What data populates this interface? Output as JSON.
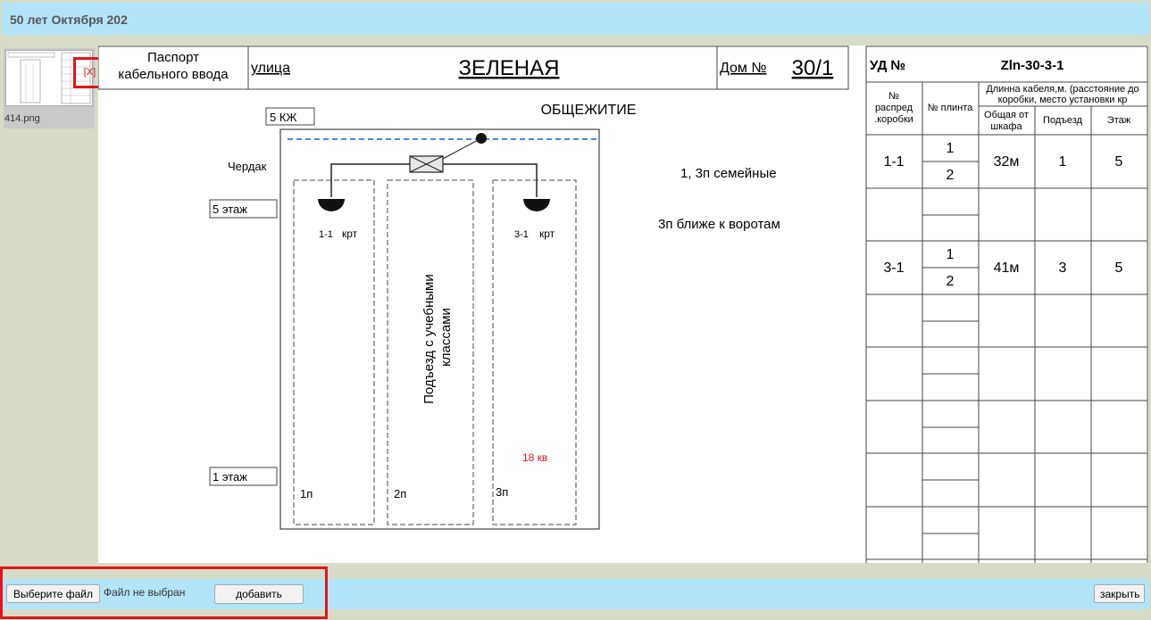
{
  "header": {
    "title": "50 лет Октября 202"
  },
  "attachment": {
    "filename": "414.png",
    "remove_label": "[X]"
  },
  "passport": {
    "label_line1": "Паспорт",
    "label_line2": "кабельного ввода",
    "street_label": "улица",
    "street_name": "ЗЕЛЕНАЯ",
    "house_label": "Дом №",
    "house_number": "30/1",
    "building_type": "ОБЩЕЖИТИЕ"
  },
  "scheme": {
    "tag_kzh": "5  КЖ",
    "attic": "Чердак",
    "floor5": "5  этаж",
    "floor1": "1  этаж",
    "box1": "1-1",
    "box1_krt": "крт",
    "box3": "3-1",
    "box3_krt": "крт",
    "entrance_note": "Подъезд с учебными классами",
    "entrance1": "1п",
    "entrance2": "2п",
    "entrance3": "3п",
    "apartments_note": "18 кв"
  },
  "notes": {
    "note1": "1, 3п семейные",
    "note2": "3п ближе к воротам"
  },
  "ud_table": {
    "ud_label": "УД №",
    "ud_number": "Zln-30-3-1",
    "col_box": "№ распред .коробки",
    "col_plint": "№ плинта",
    "col_length": "Длинна кабеля,м. (расстояние до коробки, место установки кр",
    "col_total": "Общая от шкафа",
    "col_entrance": "Подъезд",
    "col_floor": "Этаж",
    "rows": [
      {
        "box": "1-1",
        "plint1": "1",
        "plint2": "2",
        "total": "32м",
        "entrance": "1",
        "floor": "5"
      },
      {
        "box": "",
        "plint1": "",
        "plint2": "",
        "total": "",
        "entrance": "",
        "floor": ""
      },
      {
        "box": "3-1",
        "plint1": "1",
        "plint2": "2",
        "total": "41м",
        "entrance": "3",
        "floor": "5"
      },
      {
        "box": "",
        "plint1": "",
        "plint2": "",
        "total": "",
        "entrance": "",
        "floor": ""
      },
      {
        "box": "",
        "plint1": "",
        "plint2": "",
        "total": "",
        "entrance": "",
        "floor": ""
      },
      {
        "box": "",
        "plint1": "",
        "plint2": "",
        "total": "",
        "entrance": "",
        "floor": ""
      },
      {
        "box": "",
        "plint1": "",
        "plint2": "",
        "total": "",
        "entrance": "",
        "floor": ""
      },
      {
        "box": "",
        "plint1": "",
        "plint2": "",
        "total": "",
        "entrance": "",
        "floor": ""
      }
    ]
  },
  "footer": {
    "choose_file": "Выберите файл",
    "file_status": "Файл не выбран",
    "add": "добавить",
    "close": "закрыть"
  },
  "colors": {
    "bar": "#b3e5fa",
    "highlight": "#e0161a",
    "dashed_blue": "#4a86e8",
    "note_red": "#e0161a"
  }
}
